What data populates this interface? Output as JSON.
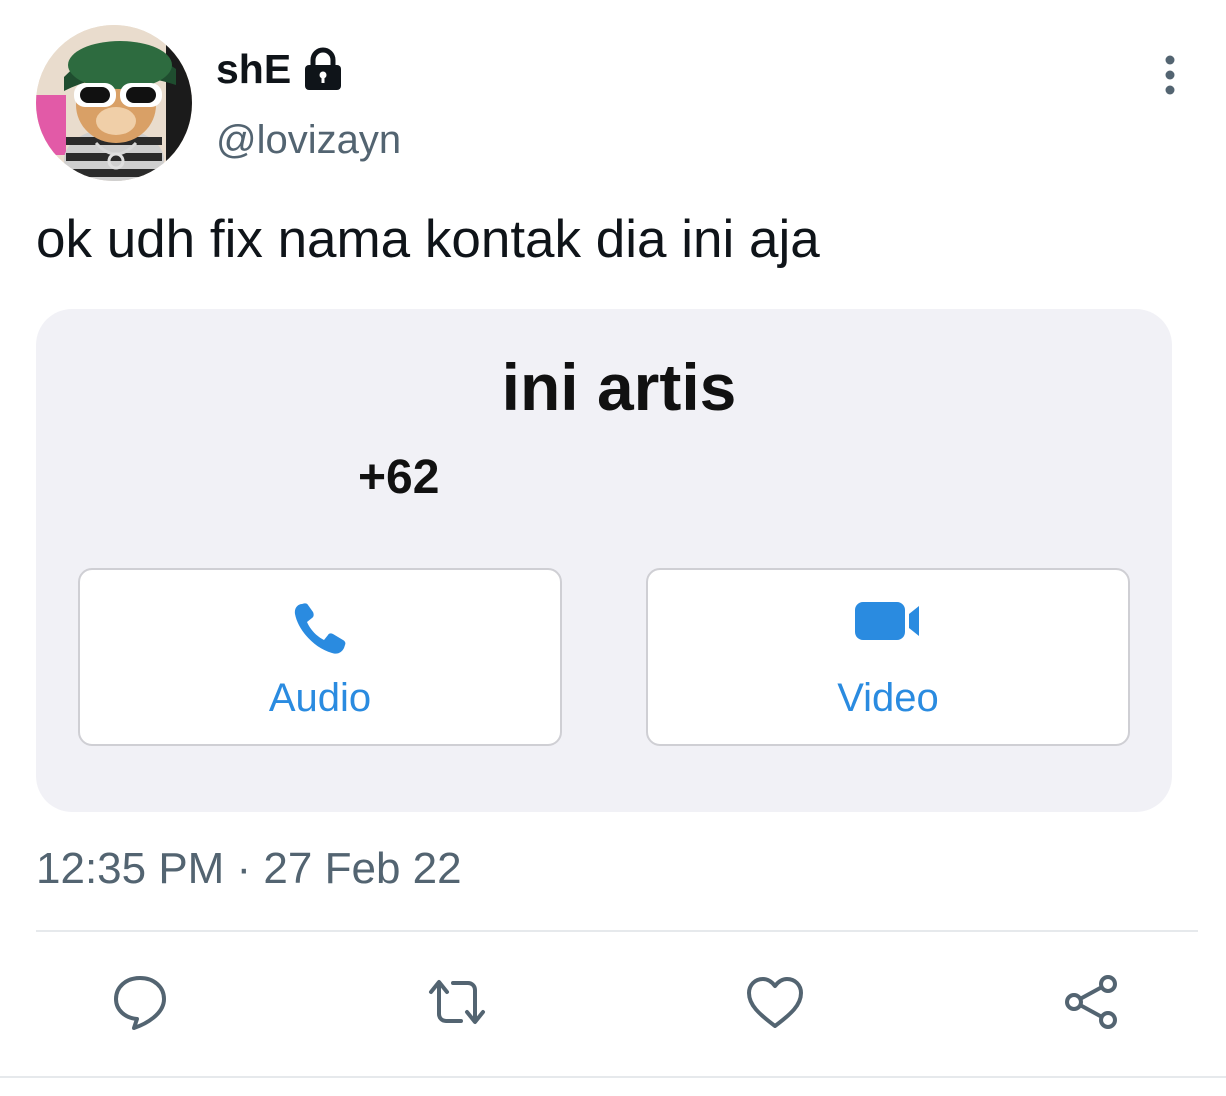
{
  "author": {
    "display_name": "shE",
    "handle": "@lovizayn",
    "avatar_icon": "avatar-cat-sunglasses",
    "protected_icon": "lock-icon"
  },
  "tweet": {
    "text": "ok udh fix nama kontak dia ini aja",
    "timestamp": "12:35 PM · 27 Feb 22"
  },
  "media": {
    "contact_name": "ini artis",
    "contact_number": "+62",
    "buttons": [
      {
        "label": "Audio",
        "icon": "phone-icon"
      },
      {
        "label": "Video",
        "icon": "video-camera-icon"
      }
    ],
    "accent_color": "#2a8be0"
  },
  "actions": [
    {
      "icon": "reply-icon"
    },
    {
      "icon": "retweet-icon"
    },
    {
      "icon": "like-icon"
    },
    {
      "icon": "share-icon"
    }
  ],
  "colors": {
    "text_primary": "#0f1419",
    "text_secondary": "#536471",
    "card_background": "#f1f1f6"
  }
}
